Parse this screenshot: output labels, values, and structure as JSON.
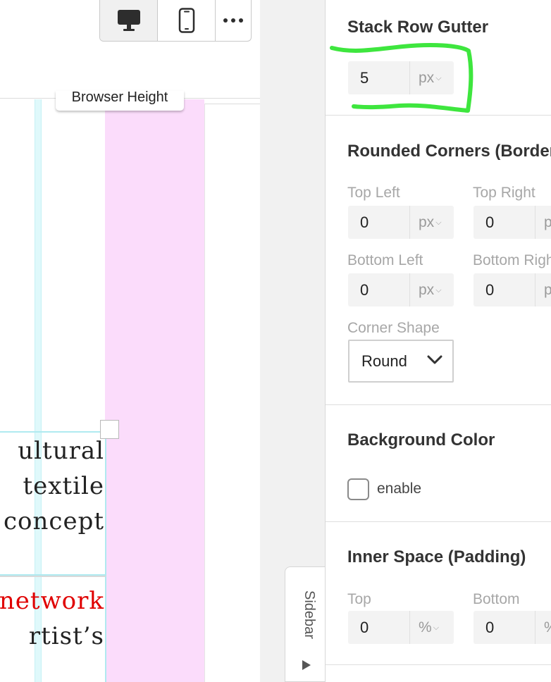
{
  "canvas": {
    "height_tooltip": "Browser Height",
    "text_lines_block1": [
      "ultural",
      "textile",
      "concept"
    ],
    "text_lines_block2": [
      "network",
      "rtist’s"
    ]
  },
  "view_switcher": {
    "desktop": "desktop-icon",
    "mobile": "mobile-icon",
    "more": "more-icon"
  },
  "sidebar_tab": {
    "label": "Sidebar"
  },
  "panel": {
    "stack_gutter": {
      "title": "Stack Row Gutter",
      "value": "5",
      "unit": "px"
    },
    "rounded": {
      "title": "Rounded Corners (Border Radius)",
      "top_left": {
        "label": "Top Left",
        "value": "0",
        "unit": "px"
      },
      "top_right": {
        "label": "Top Right",
        "value": "0",
        "unit": "px"
      },
      "bottom_left": {
        "label": "Bottom Left",
        "value": "0",
        "unit": "px"
      },
      "bottom_right": {
        "label": "Bottom Right",
        "value": "0",
        "unit": "px"
      },
      "shape_label": "Corner Shape",
      "shape_value": "Round"
    },
    "background": {
      "title": "Background Color",
      "enable_label": "enable"
    },
    "padding": {
      "title": "Inner Space (Padding)",
      "top": {
        "label": "Top",
        "value": "0",
        "unit": "%"
      },
      "bottom": {
        "label": "Bottom",
        "value": "0",
        "unit": "%"
      }
    }
  },
  "colors": {
    "annotation": "#3ee63e",
    "guide_pink": "#fbdcfb",
    "guide_cyan": "#dff9fb",
    "text_red": "#e00000"
  }
}
